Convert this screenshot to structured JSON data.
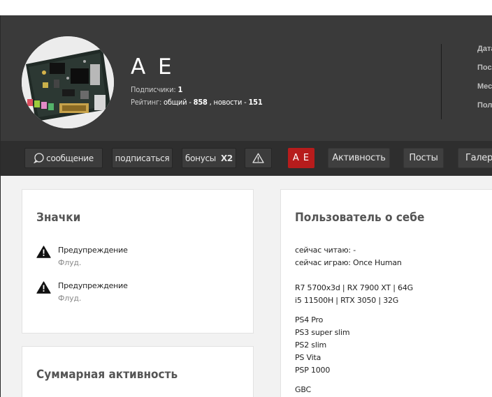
{
  "profile": {
    "username": "A E",
    "subscribers_label": "Подписчики:",
    "subscribers_count": "1",
    "rating_label": "Рейтинг:",
    "rating_general_label": "общий -",
    "rating_general_value": "858",
    "rating_news_label": ", новости -",
    "rating_news_value": "151",
    "info_labels": [
      "Дата",
      "Посл",
      "Мест",
      "Пол:"
    ]
  },
  "nav": {
    "message_label": "сообщение",
    "subscribe_label": "подписаться",
    "bonuses_label": "бонусы",
    "bonuses_value": "X2",
    "tabs": [
      "A E",
      "Активность",
      "Посты",
      "Галере"
    ]
  },
  "badges_card": {
    "title": "Значки",
    "items": [
      {
        "name": "Предупреждение",
        "description": "Флуд."
      },
      {
        "name": "Предупреждение",
        "description": "Флуд."
      }
    ]
  },
  "activity_card": {
    "title": "Суммарная активность"
  },
  "about_card": {
    "title": "Пользователь о себе",
    "lines": [
      "сейчас читаю: -",
      "сейчас играю: Once Human",
      "R7 5700x3d | RX 7900 XT | 64G",
      "i5 11500H | RTX 3050 | 32G",
      "PS4 Pro",
      "PS3 super slim",
      "PS2 slim",
      "PS Vita",
      "PSP 1000",
      "GBC"
    ]
  },
  "colors": {
    "header_bg": "#3a3a3a",
    "nav_bg": "#2e2e2e",
    "active_tab": "#b71c1c",
    "content_bg": "#f2f2f2"
  }
}
